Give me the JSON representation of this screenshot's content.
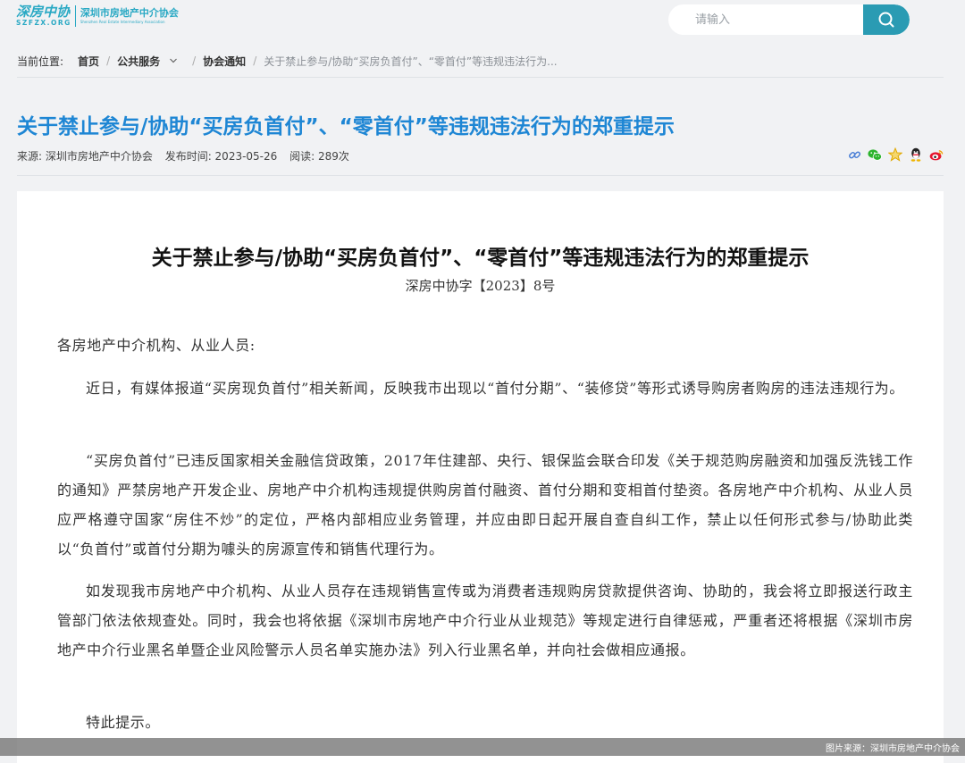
{
  "colors": {
    "brand": "#2aa9c4",
    "title_blue": "#1e86d4",
    "search_button": "#2a9bb3",
    "wechat_green": "#2cb32c",
    "star_yellow": "#f0b400",
    "weibo_red": "#e6162d"
  },
  "header": {
    "logo_cn": "深房中协",
    "logo_en": "SZFZX.ORG",
    "org_name_cn": "深圳市房地产中介协会",
    "org_name_en": "Shenzhen Real Estate Intermediary Association",
    "search_placeholder": "请输入",
    "search_icon": "search-icon"
  },
  "breadcrumb": {
    "prefix": "当前位置:",
    "home": "首页",
    "section": "公共服务",
    "category": "协会通知",
    "current": "关于禁止参与/协助“买房负首付”、“零首付”等违规违法行为...",
    "separator": "/"
  },
  "article": {
    "title": "关于禁止参与/协助“买房负首付”、“零首付”等违规违法行为的郑重提示",
    "meta": {
      "source": "来源:  深圳市房地产中介协会",
      "published": "发布时间:  2023-05-26",
      "reads": "阅读:  289次"
    },
    "share_icons": [
      "link-icon",
      "wechat-icon",
      "star-icon",
      "qq-icon",
      "weibo-icon"
    ]
  },
  "document": {
    "title": "关于禁止参与/协助“买房负首付”、“零首付”等违规违法行为的郑重提示",
    "number": "深房中协字【2023】8号",
    "salutation": "各房地产中介机构、从业人员:",
    "paragraphs": [
      "近日，有媒体报道“买房现负首付”相关新闻，反映我市出现以“首付分期”、“装修贷”等形式诱导购房者购房的违法违规行为。",
      "“买房负首付”已违反国家相关金融信贷政策，2017年住建部、央行、银保监会联合印发《关于规范购房融资和加强反洗钱工作的通知》严禁房地产开发企业、房地产中介机构违规提供购房首付融资、首付分期和变相首付垫资。各房地产中介机构、从业人员应严格遵守国家“房住不炒”的定位，严格内部相应业务管理，并应由即日起开展自查自纠工作，禁止以任何形式参与/协助此类以“负首付”或首付分期为噱头的房源宣传和销售代理行为。",
      "如发现我市房地产中介机构、从业人员存在违规销售宣传或为消费者违规购房贷款提供咨询、协助的，我会将立即报送行政主管部门依法依规查处。同时，我会也将依据《深圳市房地产中介行业从业规范》等规定进行自律惩戒，严重者还将根据《深圳市房地产中介行业黑名单暨企业风险警示人员名单实施办法》列入行业黑名单，并向社会做相应通报。"
    ],
    "closing": "特此提示。"
  },
  "image_credit": "图片来源：深圳市房地产中介协会"
}
